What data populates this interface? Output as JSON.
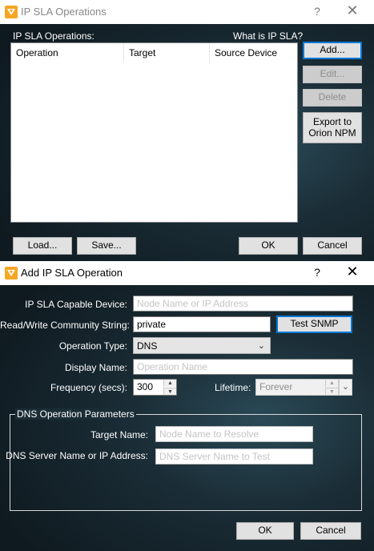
{
  "window1": {
    "title": "IP SLA Operations",
    "help_glyph": "?",
    "close_glyph": "✕",
    "section_label": "IP SLA Operations:",
    "what_is_link": "What is IP SLA?",
    "columns": [
      "Operation",
      "Target",
      "Source Device"
    ],
    "add_button": "Add...",
    "edit_button": "Edit...",
    "delete_button": "Delete",
    "export_button": "Export to Orion NPM",
    "load_button": "Load...",
    "save_button": "Save...",
    "ok_button": "OK",
    "cancel_button": "Cancel"
  },
  "window2": {
    "title": "Add IP SLA Operation",
    "help_glyph": "?",
    "close_glyph": "✕",
    "device_label": "IP SLA Capable Device:",
    "device_placeholder": "Node Name or IP Address",
    "community_label": "Read/Write Community String:",
    "community_value": "private",
    "test_snmp_button": "Test SNMP",
    "operation_type_label": "Operation Type:",
    "operation_type_value": "DNS",
    "display_name_label": "Display Name:",
    "display_name_placeholder": "Operation Name",
    "frequency_label": "Frequency (secs):",
    "frequency_value": "300",
    "lifetime_label": "Lifetime:",
    "lifetime_value": "Forever",
    "group_title": "DNS Operation Parameters",
    "target_name_label": "Target Name:",
    "target_name_placeholder": "Node Name to Resolve",
    "dns_server_label": "DNS Server Name or IP Address:",
    "dns_server_placeholder": "DNS Server Name to Test",
    "ok_button": "OK",
    "cancel_button": "Cancel"
  },
  "icons": {
    "app_icon": "solarwinds-logo-icon",
    "dropdown": "chevron-down-icon",
    "spin_up": "spin-up-icon",
    "spin_down": "spin-down-icon"
  },
  "colors": {
    "accent": "#0078d7",
    "logo": "#f5a623"
  }
}
